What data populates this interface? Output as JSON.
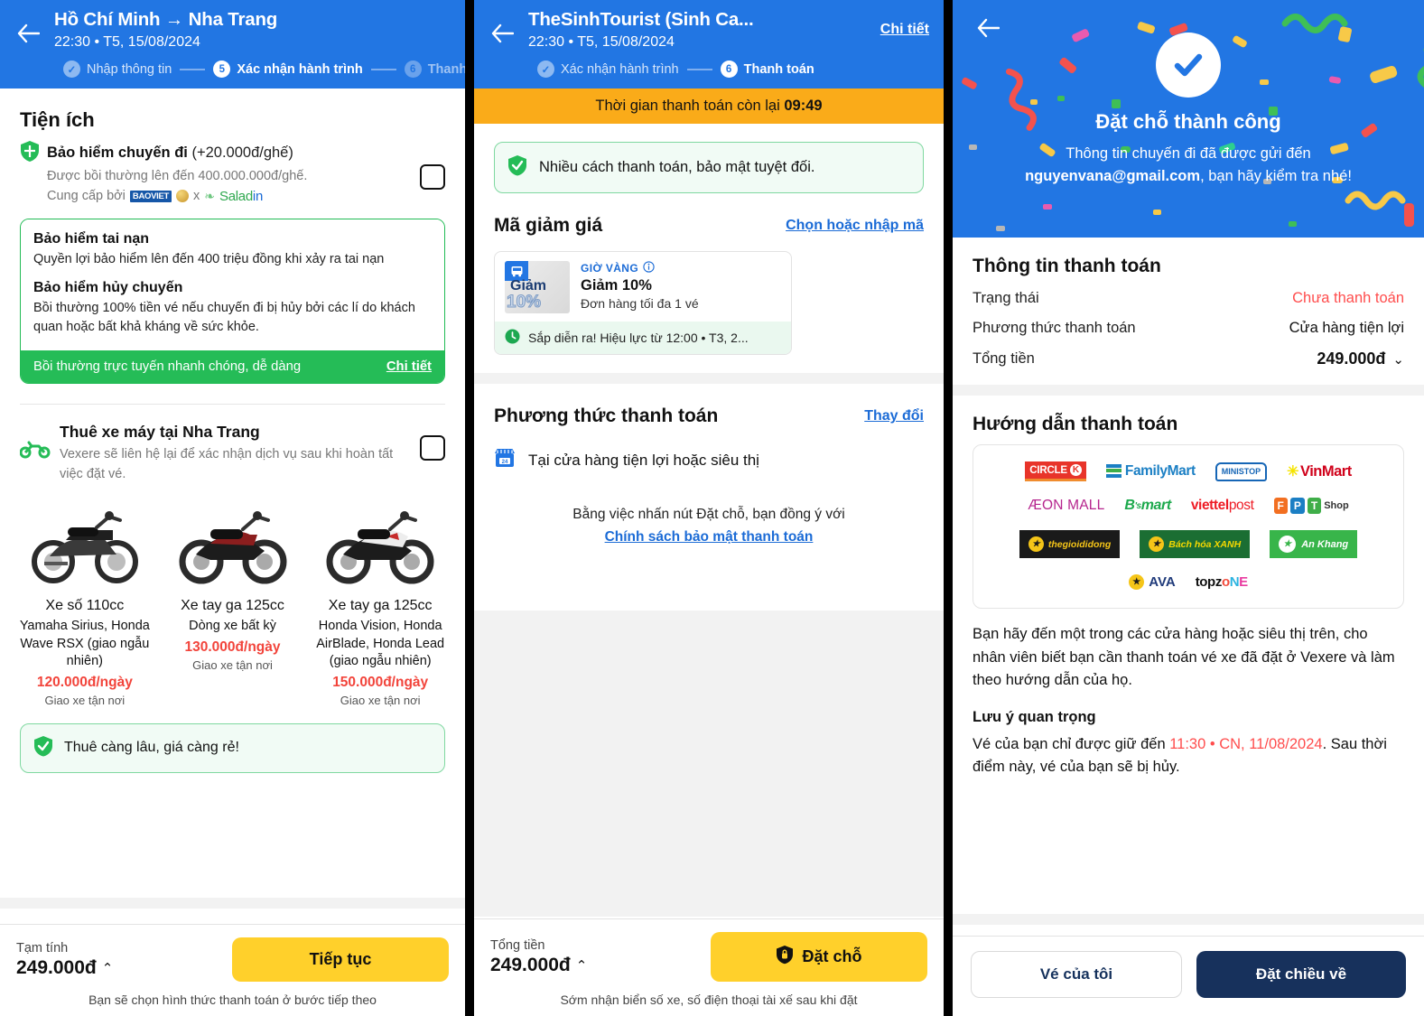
{
  "panel1": {
    "header": {
      "back_icon": "back-arrow-icon",
      "title": "Hồ Chí Minh → Nha Trang",
      "subtitle": "22:30 • T5, 15/08/2024",
      "steps": [
        {
          "badge": "✓",
          "label": "Nhập thông tin",
          "state": "done"
        },
        {
          "badge": "5",
          "label": "Xác nhận hành trình",
          "state": "current"
        },
        {
          "badge": "6",
          "label": "Thanh",
          "state": "next"
        }
      ]
    },
    "section_title": "Tiện ích",
    "insurance": {
      "icon": "shield-icon",
      "title": "Bảo hiểm chuyến đi",
      "title_suffix": "(+20.000đ/ghế)",
      "desc": "Được bồi thường lên đến 400.000.000đ/ghế.",
      "provider_prefix": "Cung cấp bởi",
      "provider_1": "BAOVIET",
      "provider_x": "x",
      "provider_2a": "Salad",
      "provider_2b": "in",
      "checkbox_checked": false
    },
    "insurance_card": {
      "block1_title": "Bảo hiểm tai nạn",
      "block1_text": "Quyền lợi bảo hiểm lên đến 400 triệu đồng khi xảy ra tai nạn",
      "block2_title": "Bảo hiểm hủy chuyến",
      "block2_text": "Bồi thường 100% tiền vé nếu chuyến đi bị hủy bởi các lí do khách quan hoặc bất khả kháng về sức khỏe.",
      "footer_text": "Bồi thường trực tuyến nhanh chóng, dễ dàng",
      "footer_link": "Chi tiết"
    },
    "bike_rental": {
      "icon": "motorbike-icon",
      "title": "Thuê xe máy tại Nha Trang",
      "desc": "Vexere sẽ liên hệ lại để xác nhận dịch vụ sau khi hoàn tất việc đặt vé.",
      "checkbox_checked": false,
      "options": [
        {
          "name": "Xe số 110cc",
          "models": "Yamaha Sirius, Honda Wave RSX (giao ngẫu nhiên)",
          "price": "120.000đ/ngày",
          "note": "Giao xe tận nơi"
        },
        {
          "name": "Xe tay ga 125cc",
          "models": "Dòng xe bất kỳ",
          "price": "130.000đ/ngày",
          "note": "Giao xe tận nơi"
        },
        {
          "name": "Xe tay ga 125cc",
          "models": "Honda Vision, Honda AirBlade, Honda Lead (giao ngẫu nhiên)",
          "price": "150.000đ/ngày",
          "note": "Giao xe tận nơi"
        }
      ]
    },
    "tip": {
      "icon": "check-shield-icon",
      "text": "Thuê càng lâu, giá càng rẻ!"
    },
    "bottom": {
      "label": "Tạm tính",
      "amount": "249.000đ",
      "caret": "⌃",
      "cta": "Tiếp tục",
      "foot": "Bạn sẽ chọn hình thức thanh toán ở bước tiếp theo"
    }
  },
  "panel2": {
    "header": {
      "back_icon": "back-arrow-icon",
      "title": "TheSinhTourist (Sinh Ca...",
      "subtitle": "22:30 • T5, 15/08/2024",
      "detail_link": "Chi tiết",
      "steps": [
        {
          "badge": "✓",
          "label": "Xác nhận hành trình",
          "state": "done"
        },
        {
          "badge": "6",
          "label": "Thanh toán",
          "state": "current"
        }
      ]
    },
    "timer_prefix": "Thời gian thanh toán còn lại",
    "timer_value": "09:49",
    "notice": {
      "icon": "check-shield-icon",
      "text": "Nhiều cách thanh toán, bảo mật tuyệt đối."
    },
    "promo": {
      "heading": "Mã giảm giá",
      "action": "Chọn hoặc nhập mã",
      "card": {
        "image_bus_icon": "bus-icon",
        "image_line1": "Giảm",
        "image_line2": "10%",
        "tag": "GIỜ VÀNG",
        "tag_icon": "info-icon",
        "title": "Giảm 10%",
        "subtitle": "Đơn hàng tối đa 1 vé",
        "footer_icon": "clock-icon",
        "footer": "Sắp diễn ra! Hiệu lực từ 12:00 • T3, 2..."
      }
    },
    "payment": {
      "heading": "Phương thức thanh toán",
      "action": "Thay đổi",
      "method_icon": "store-24-icon",
      "method_label": "Tại cửa hàng tiện lợi hoặc siêu thị",
      "agree_text": "Bằng việc nhấn nút Đặt chỗ, bạn đồng ý với",
      "agree_link": "Chính sách bảo mật thanh toán"
    },
    "bottom": {
      "label": "Tổng tiền",
      "amount": "249.000đ",
      "caret": "⌃",
      "cta_icon": "shield-lock-icon",
      "cta": "Đặt chỗ",
      "foot": "Sớm nhận biển số xe, số điện thoại tài xế sau khi đặt"
    }
  },
  "panel3": {
    "hero": {
      "back_icon": "back-arrow-icon",
      "check_icon": "check-circle-icon",
      "title": "Đặt chỗ thành công",
      "line1": "Thông tin chuyến đi đã được gửi đến",
      "email": "nguyenvana@gmail.com",
      "line2": ", bạn hãy kiểm tra nhé!"
    },
    "payment_info": {
      "heading": "Thông tin thanh toán",
      "rows": [
        {
          "key": "Trạng thái",
          "value": "Chưa thanh toán",
          "style": "red"
        },
        {
          "key": "Phương thức thanh toán",
          "value": "Cửa hàng tiện lợi",
          "style": "plain"
        },
        {
          "key": "Tổng tiền",
          "value": "249.000đ",
          "style": "bold",
          "caret": "⌄"
        }
      ]
    },
    "guide": {
      "heading": "Hướng dẫn thanh toán",
      "stores": [
        [
          "CIRCLE K",
          "FamilyMart",
          "MINI STOP",
          "VinMart"
        ],
        [
          "ÆON MALL",
          "B'smart",
          "viettel post",
          "FPT Shop"
        ],
        [
          "thegioididong",
          "Bách hóa XANH",
          "An Khang"
        ],
        [
          "AVA",
          "topzone"
        ]
      ],
      "body": "Bạn hãy đến một trong các cửa hàng hoặc siêu thị trên, cho nhân viên biết bạn cần thanh toán vé xe đã đặt ở Vexere và làm theo hướng dẫn của họ.",
      "note_heading": "Lưu ý quan trọng",
      "note_pre": "Vé của bạn chỉ được giữ đến ",
      "note_time": "11:30 • CN, 11/08/2024",
      "note_post": ". Sau thời điểm này, vé của bạn sẽ bị hủy."
    },
    "bottom": {
      "secondary": "Vé của tôi",
      "primary": "Đặt chiều về"
    }
  },
  "colors": {
    "brand_blue": "#2276E3",
    "accent_yellow": "#FFD02B",
    "timer_orange": "#FAAB19",
    "success_green": "#25BC57",
    "danger_red": "#FF4D4D",
    "price_red": "#F2443B",
    "navy": "#17315C"
  }
}
